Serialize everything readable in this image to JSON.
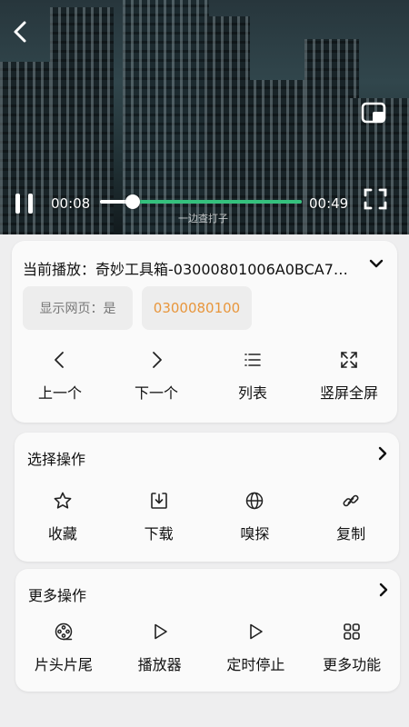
{
  "player": {
    "current_time": "00:08",
    "duration": "00:49",
    "progress": 0.16,
    "subtitle": "一边查打子"
  },
  "now_playing": {
    "label": "当前播放：",
    "title": "奇妙工具箱-03000801006A0BCA7…",
    "show_webpage_chip": "显示网页：是",
    "code_chip": "0300080100"
  },
  "nav_actions": [
    {
      "label": "上一个",
      "icon": "chevron-left-icon"
    },
    {
      "label": "下一个",
      "icon": "chevron-right-icon"
    },
    {
      "label": "列表",
      "icon": "list-icon"
    },
    {
      "label": "竖屏全屏",
      "icon": "expand-icon"
    }
  ],
  "select_ops": {
    "title": "选择操作",
    "items": [
      {
        "label": "收藏",
        "icon": "star-icon"
      },
      {
        "label": "下载",
        "icon": "download-icon"
      },
      {
        "label": "嗅探",
        "icon": "globe-icon"
      },
      {
        "label": "复制",
        "icon": "link-icon"
      }
    ]
  },
  "more_ops": {
    "title": "更多操作",
    "items": [
      {
        "label": "片头片尾",
        "icon": "film-reel-icon"
      },
      {
        "label": "播放器",
        "icon": "play-icon"
      },
      {
        "label": "定时停止",
        "icon": "play-outline-icon"
      },
      {
        "label": "更多功能",
        "icon": "grid-icon"
      }
    ]
  },
  "colors": {
    "accent_orange": "#e8963c",
    "seek_green": "#35c07d",
    "background": "#eeeeef",
    "card": "#fafafa"
  }
}
